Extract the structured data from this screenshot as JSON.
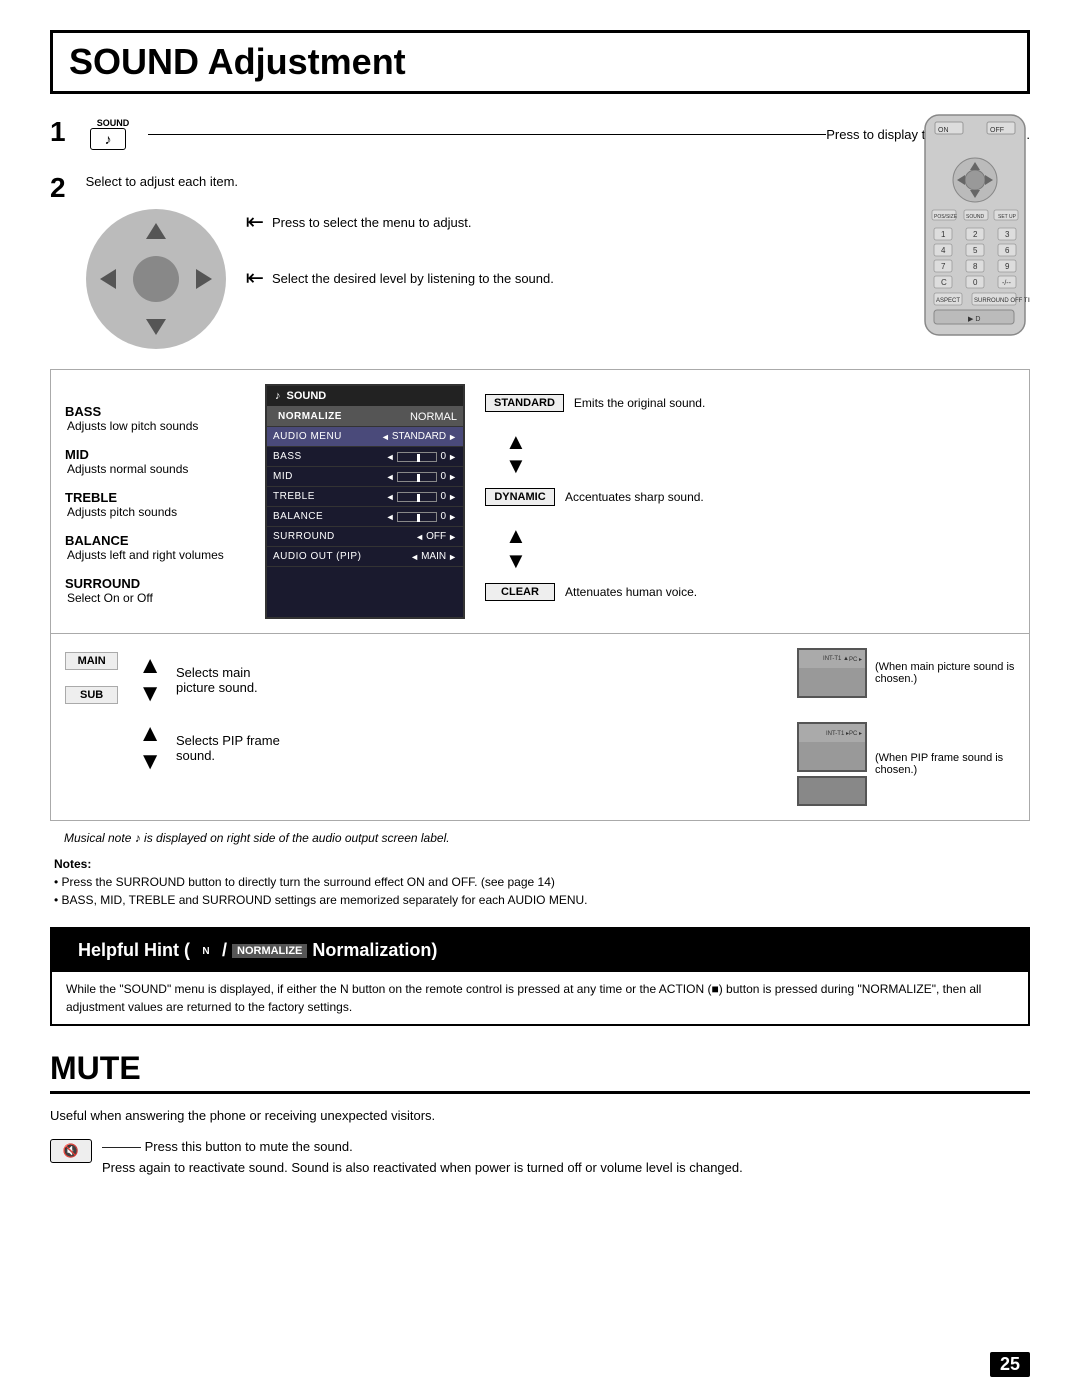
{
  "page": {
    "title": "SOUND Adjustment",
    "mute_title": "MUTE"
  },
  "step1": {
    "number": "1",
    "sound_label": "SOUND",
    "note_char": "♪",
    "press_text": "Press to display the SOUND menu."
  },
  "step2": {
    "number": "2",
    "select_text": "Select to adjust each item.",
    "instr1": "Press to select the menu to adjust.",
    "instr2": "Select the desired level by listening to the sound."
  },
  "labels": {
    "bass_title": "BASS",
    "bass_desc": "Adjusts low pitch sounds",
    "mid_title": "MID",
    "mid_desc": "Adjusts normal sounds",
    "treble_title": "TREBLE",
    "treble_desc": "Adjusts pitch sounds",
    "balance_title": "BALANCE",
    "balance_desc": "Adjusts left and right volumes",
    "surround_title": "SURROUND",
    "surround_desc": "Select On or Off"
  },
  "sound_menu": {
    "header_icon": "♪",
    "header_title": "SOUND",
    "normalize_label": "NORMALIZE",
    "normalize_value": "NORMAL",
    "rows": [
      {
        "label": "AUDIO MENU",
        "value": "STANDARD",
        "has_arrows": true
      },
      {
        "label": "BASS",
        "value": "0",
        "has_bar": true
      },
      {
        "label": "MID",
        "value": "0",
        "has_bar": true
      },
      {
        "label": "TREBLE",
        "value": "0",
        "has_bar": true
      },
      {
        "label": "BALANCE",
        "value": "0",
        "has_bar": true
      },
      {
        "label": "SURROUND",
        "value": "OFF",
        "has_arrows": true
      },
      {
        "label": "AUDIO OUT (PIP)",
        "value": "MAIN",
        "has_arrows": true
      }
    ]
  },
  "right_options": {
    "standard_label": "STANDARD",
    "standard_desc": "Emits the original sound.",
    "dynamic_label": "DYNAMIC",
    "dynamic_desc": "Accentuates sharp sound.",
    "clear_label": "CLEAR",
    "clear_desc": "Attenuates human voice."
  },
  "audio_out": {
    "main_label": "MAIN",
    "main_desc1": "Selects main",
    "main_desc2": "picture sound.",
    "sub_label": "SUB",
    "sub_desc1": "Selects PIP frame",
    "sub_desc2": "sound."
  },
  "tv_screens": {
    "screen1_desc": "(When main picture sound is chosen.)",
    "screen2_desc": "(When PIP frame sound is chosen.)"
  },
  "musical_note_text": "Musical note ♪ is displayed on right side of the audio output screen label.",
  "notes": {
    "title": "Notes:",
    "note1": "Press the SURROUND button to directly turn the surround effect ON and OFF. (see page 14)",
    "note2": "BASS, MID, TREBLE and SURROUND settings are memorized separately for each AUDIO MENU."
  },
  "helpful_hint": {
    "title": "Helpful Hint (",
    "n_label": "N",
    "slash": "/",
    "normalize_badge": "NORMALIZE",
    "title_end": "Normalization)",
    "content": "While the \"SOUND\" menu is displayed, if either the N button on the remote control is pressed at any time or the ACTION (■) button is pressed during \"NORMALIZE\", then all adjustment values are returned to the factory settings."
  },
  "mute": {
    "title": "MUTE",
    "desc": "Useful when answering the phone or receiving unexpected visitors.",
    "btn_symbol": "🔇",
    "press_text": "Press this button to mute the sound.",
    "press_again": "Press again to reactivate sound. Sound is also reactivated when power is turned off or volume level is changed."
  },
  "page_number": "25"
}
